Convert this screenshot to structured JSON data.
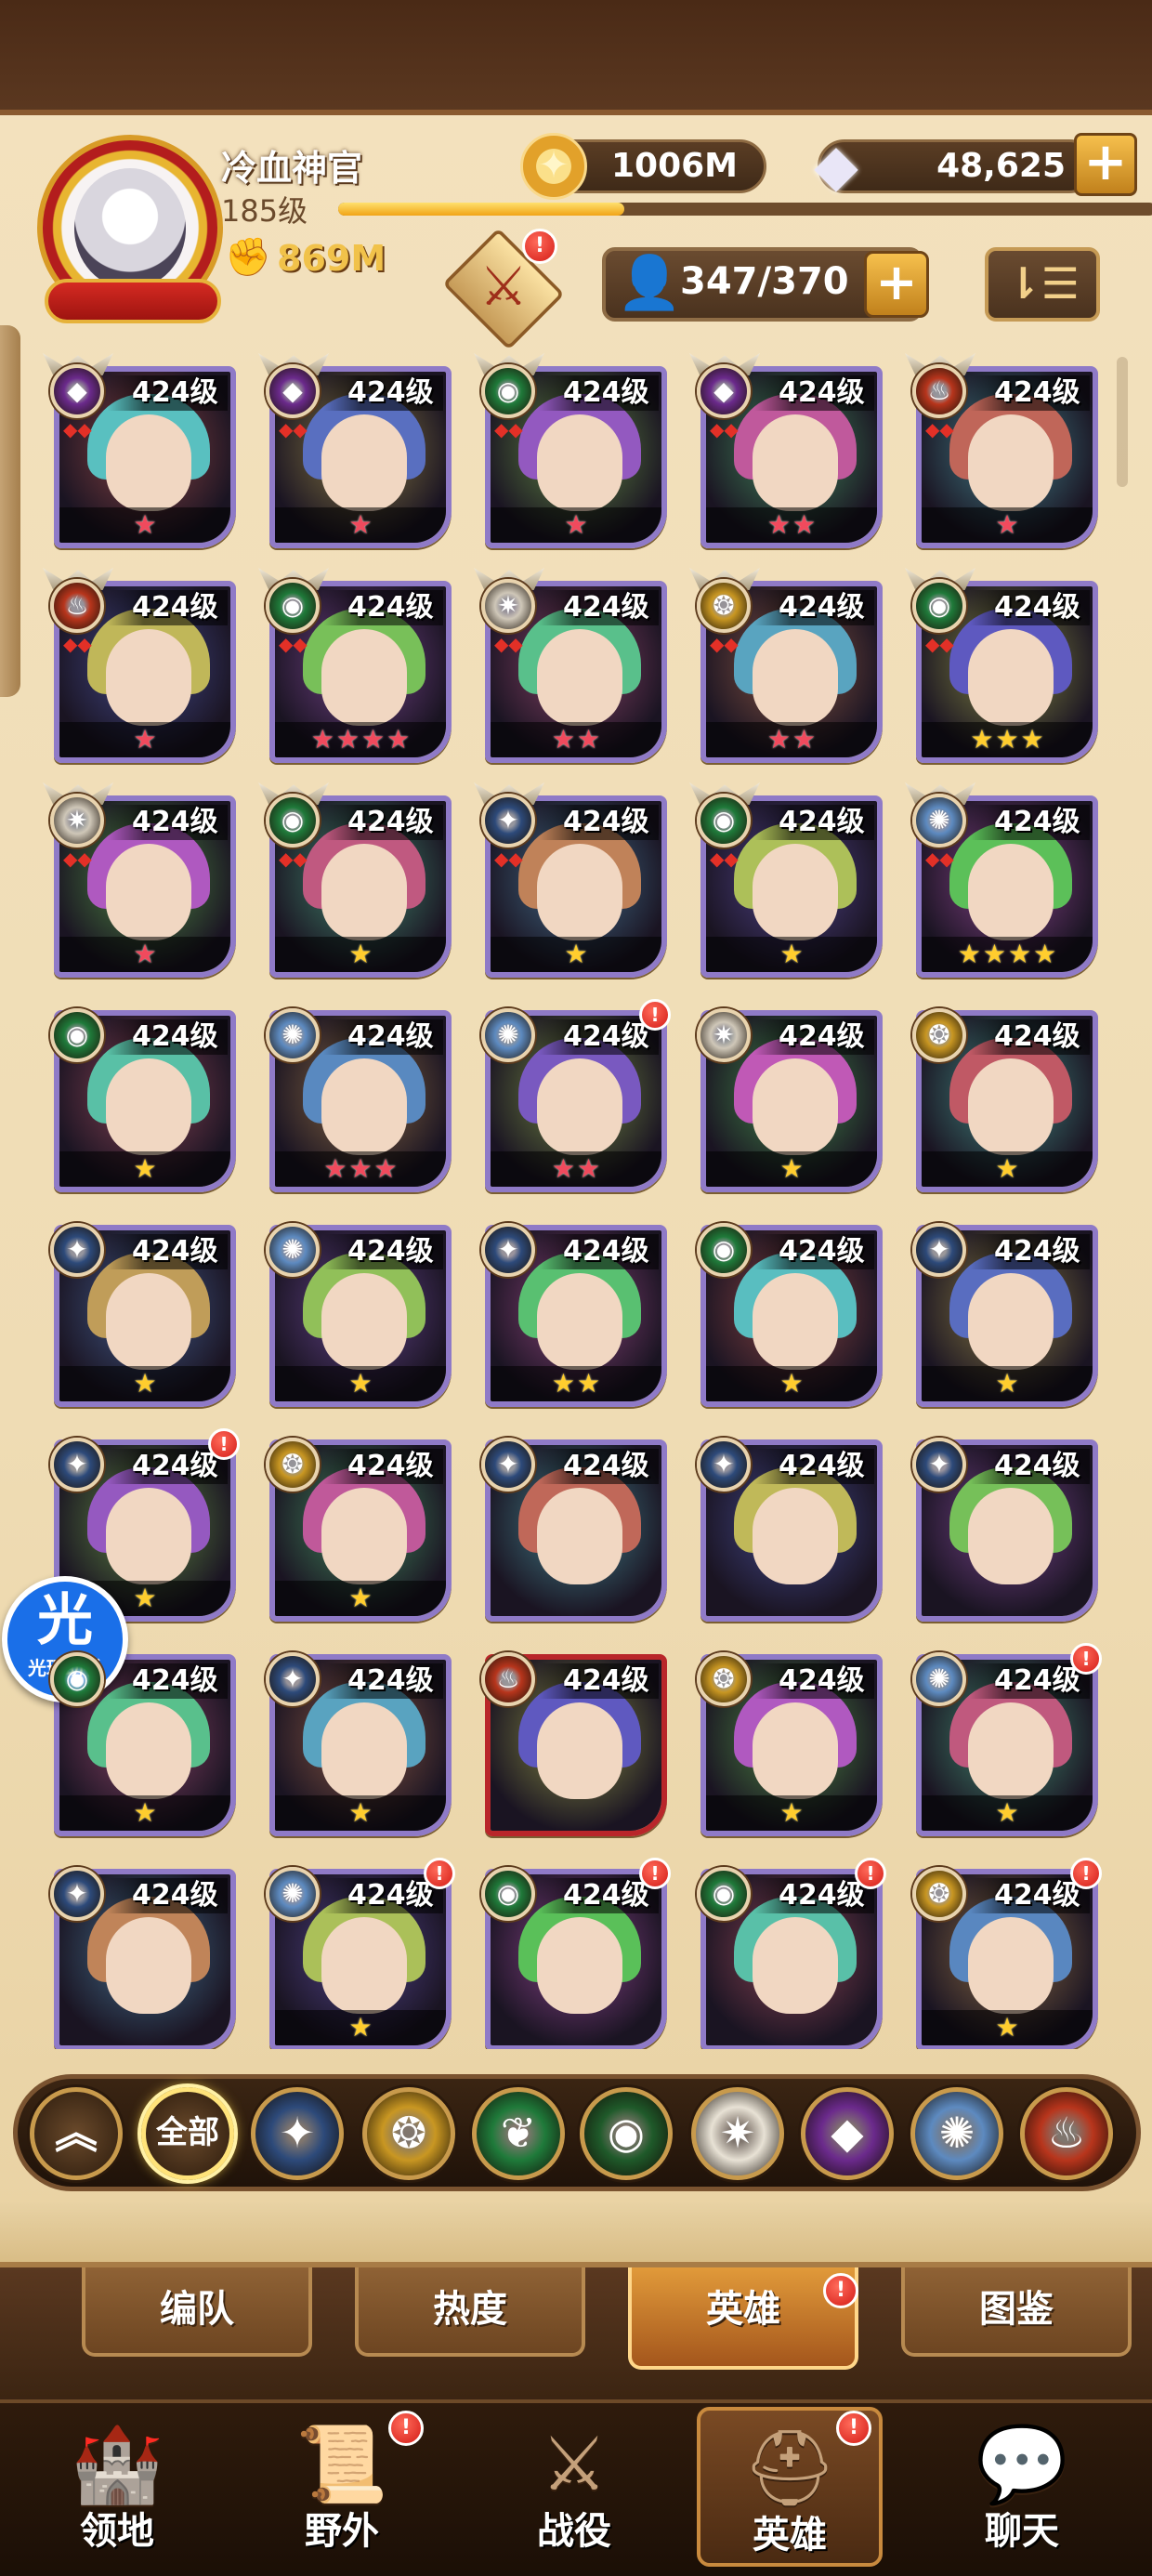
{
  "player": {
    "name": "冷血神官",
    "level": "185级",
    "exp_fraction": 0.35,
    "power": "869M"
  },
  "resources": {
    "gold": "1006M",
    "gems": "48,625",
    "add_label": "+"
  },
  "camp": {
    "badge": "!"
  },
  "hero_count": {
    "value": "347/370",
    "add_label": "+"
  },
  "sort_label": "⇂☰",
  "hero_level_label": "424级",
  "heroes": [
    {
      "faction": "mauler",
      "stars": 1,
      "star_color": "red",
      "alert": false
    },
    {
      "faction": "mauler",
      "stars": 1,
      "star_color": "red",
      "alert": false
    },
    {
      "faction": "wilder",
      "stars": 1,
      "star_color": "red",
      "alert": false
    },
    {
      "faction": "mauler",
      "stars": 2,
      "star_color": "red",
      "alert": false
    },
    {
      "faction": "hypogean",
      "stars": 1,
      "star_color": "red",
      "alert": false
    },
    {
      "faction": "hypogean",
      "stars": 1,
      "star_color": "red",
      "alert": false
    },
    {
      "faction": "wilder",
      "stars": 4,
      "star_color": "red",
      "alert": false
    },
    {
      "faction": "celestial",
      "stars": 2,
      "star_color": "red",
      "alert": false
    },
    {
      "faction": "graveborn",
      "stars": 2,
      "star_color": "red",
      "alert": false
    },
    {
      "faction": "wilder",
      "stars": 3,
      "star_color": "gold",
      "alert": false
    },
    {
      "faction": "celestial",
      "stars": 1,
      "star_color": "red",
      "alert": false
    },
    {
      "faction": "wilder",
      "stars": 1,
      "star_color": "gold",
      "alert": false
    },
    {
      "faction": "lightbearer",
      "stars": 1,
      "star_color": "gold",
      "alert": false
    },
    {
      "faction": "wilder",
      "stars": 1,
      "star_color": "gold",
      "alert": false
    },
    {
      "faction": "dimensional",
      "stars": 4,
      "star_color": "gold",
      "alert": false
    },
    {
      "faction": "wilder",
      "stars": 1,
      "star_color": "gold",
      "alert": false
    },
    {
      "faction": "dimensional",
      "stars": 3,
      "star_color": "red",
      "alert": false
    },
    {
      "faction": "dimensional",
      "stars": 2,
      "star_color": "red",
      "alert": true
    },
    {
      "faction": "celestial",
      "stars": 1,
      "star_color": "gold",
      "alert": false
    },
    {
      "faction": "graveborn",
      "stars": 1,
      "star_color": "gold",
      "alert": false
    },
    {
      "faction": "lightbearer",
      "stars": 1,
      "star_color": "gold",
      "alert": false
    },
    {
      "faction": "dimensional",
      "stars": 1,
      "star_color": "gold",
      "alert": false
    },
    {
      "faction": "lightbearer",
      "stars": 2,
      "star_color": "gold",
      "alert": false
    },
    {
      "faction": "wilder",
      "stars": 1,
      "star_color": "gold",
      "alert": false
    },
    {
      "faction": "lightbearer",
      "stars": 1,
      "star_color": "gold",
      "alert": false
    },
    {
      "faction": "lightbearer",
      "stars": 1,
      "star_color": "gold",
      "alert": true
    },
    {
      "faction": "graveborn",
      "stars": 1,
      "star_color": "gold",
      "alert": false
    },
    {
      "faction": "lightbearer",
      "stars": 0,
      "star_color": "gold",
      "alert": false
    },
    {
      "faction": "lightbearer",
      "stars": 0,
      "star_color": "gold",
      "alert": false
    },
    {
      "faction": "lightbearer",
      "stars": 0,
      "star_color": "gold",
      "alert": false
    },
    {
      "faction": "wilder",
      "stars": 1,
      "star_color": "gold",
      "alert": false
    },
    {
      "faction": "lightbearer",
      "stars": 1,
      "star_color": "gold",
      "alert": false
    },
    {
      "faction": "hypogean",
      "stars": 0,
      "star_color": "gold",
      "alert": false,
      "red_frame": true
    },
    {
      "faction": "graveborn",
      "stars": 1,
      "star_color": "gold",
      "alert": false
    },
    {
      "faction": "dimensional",
      "stars": 1,
      "star_color": "gold",
      "alert": true
    },
    {
      "faction": "lightbearer",
      "stars": 0,
      "star_color": "gold",
      "alert": false
    },
    {
      "faction": "dimensional",
      "stars": 1,
      "star_color": "gold",
      "alert": true
    },
    {
      "faction": "wilder",
      "stars": 0,
      "star_color": "gold",
      "alert": true
    },
    {
      "faction": "wilder",
      "stars": 0,
      "star_color": "gold",
      "alert": true
    },
    {
      "faction": "graveborn",
      "stars": 1,
      "star_color": "gold",
      "alert": true
    }
  ],
  "faction_colors": {
    "lightbearer": "#2d4a7a",
    "mauler": "#6b2a8c",
    "wilder": "#1f7a3a",
    "graveborn": "#c99722",
    "celestial": "#cfc7b8",
    "hypogean": "#b8351c",
    "dimensional": "#5d8ac0"
  },
  "helper": {
    "glyph": "光",
    "label": "光环助手"
  },
  "filter_bar": {
    "collapse_icon": "︽",
    "all_label": "全部",
    "factions": [
      "lightbearer-icon",
      "graveborn-icon",
      "wilder-icon",
      "wilder-eye-icon",
      "celestial-icon",
      "mauler-icon",
      "dimensional-icon",
      "hypogean-icon"
    ]
  },
  "sub_tabs": [
    {
      "label": "编队",
      "active": false,
      "alert": false
    },
    {
      "label": "热度",
      "active": false,
      "alert": false
    },
    {
      "label": "英雄",
      "active": true,
      "alert": true
    },
    {
      "label": "图鉴",
      "active": false,
      "alert": false
    }
  ],
  "bottom_nav": [
    {
      "label": "领地",
      "icon": "castle-icon",
      "active": false,
      "alert": false
    },
    {
      "label": "野外",
      "icon": "map-scroll-icon",
      "active": false,
      "alert": true
    },
    {
      "label": "战役",
      "icon": "battle-sword-icon",
      "active": false,
      "alert": false
    },
    {
      "label": "英雄",
      "icon": "hero-helmet-icon",
      "active": true,
      "alert": true
    },
    {
      "label": "聊天",
      "icon": "chat-bubble-icon",
      "active": false,
      "alert": false
    }
  ]
}
